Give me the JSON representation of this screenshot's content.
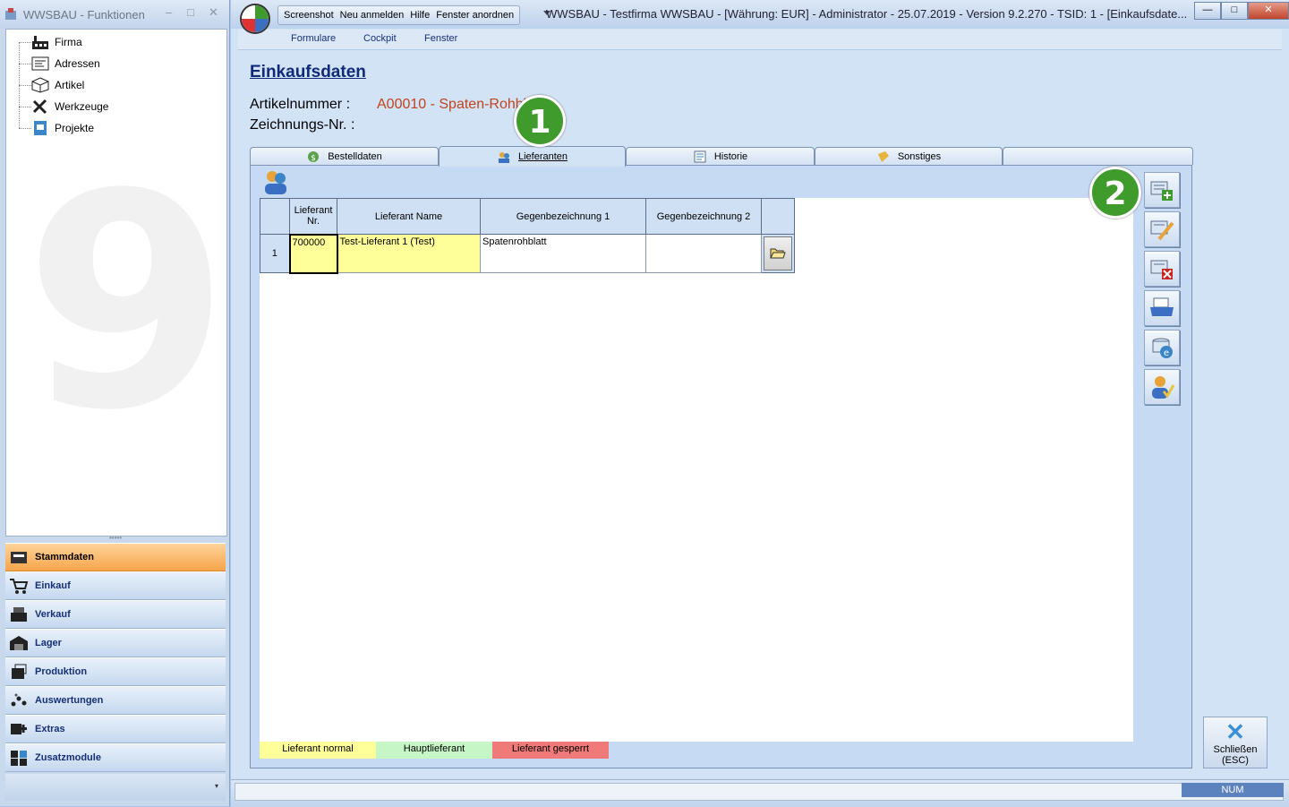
{
  "left_window": {
    "title": "WWSBAU - Funktionen",
    "controls": {
      "minimize": "–",
      "maximize": "□",
      "close": "✕"
    },
    "watermark": "9",
    "tree": [
      {
        "label": "Firma",
        "icon": "factory-icon"
      },
      {
        "label": "Adressen",
        "icon": "address-card-icon"
      },
      {
        "label": "Artikel",
        "icon": "package-icon"
      },
      {
        "label": "Werkzeuge",
        "icon": "tools-icon"
      },
      {
        "label": "Projekte",
        "icon": "project-icon"
      }
    ],
    "nav": [
      {
        "label": "Stammdaten",
        "active": true
      },
      {
        "label": "Einkauf"
      },
      {
        "label": "Verkauf"
      },
      {
        "label": "Lager"
      },
      {
        "label": "Produktion"
      },
      {
        "label": "Auswertungen"
      },
      {
        "label": "Extras"
      },
      {
        "label": "Zusatzmodule"
      }
    ],
    "footer_chevron": "▾"
  },
  "main_window": {
    "quick_access": [
      "Screenshot",
      "Neu anmelden",
      "Hilfe",
      "Fenster anordnen"
    ],
    "title": "WWSBAU - Testfirma WWSBAU - [Währung: EUR] - Administrator - 25.07.2019 - Version 9.2.270 - TSID: 1  - [Einkaufsdate...",
    "controls": {
      "minimize": "—",
      "maximize": "□",
      "close": "✕"
    },
    "menu": [
      "Formulare",
      "Cockpit",
      "Fenster"
    ]
  },
  "page": {
    "title": "Einkaufsdaten",
    "artikelnummer_label": "Artikelnummer :",
    "artikelnummer_value": "A00010 - Spaten-Rohblatt",
    "zeichnung_label": "Zeichnungs-Nr. :"
  },
  "badges": [
    "1",
    "2"
  ],
  "tabs": [
    {
      "label": "Bestelldaten",
      "icon": "money-icon"
    },
    {
      "label": "Lieferanten",
      "icon": "suppliers-icon",
      "active": true
    },
    {
      "label": "Historie",
      "icon": "history-icon"
    },
    {
      "label": "Sonstiges",
      "icon": "misc-icon"
    }
  ],
  "grid": {
    "columns": [
      "Lieferant Nr.",
      "Lieferant Name",
      "Gegenbezeichnung 1",
      "Gegenbezeichnung 2"
    ],
    "rows": [
      {
        "num": "1",
        "lieferant_nr": "700000",
        "lieferant_name": "Test-Lieferant 1  (Test)",
        "gegen1": "Spatenrohblatt",
        "gegen2": ""
      }
    ]
  },
  "legend": [
    {
      "label": "Lieferant normal",
      "color": "#ffff99"
    },
    {
      "label": "Hauptlieferant",
      "color": "#c6f5c6"
    },
    {
      "label": "Lieferant gesperrt",
      "color": "#f07a7a"
    }
  ],
  "side_buttons": [
    "add-record-icon",
    "edit-record-icon",
    "delete-record-icon",
    "print-icon",
    "refresh-icon",
    "user-check-icon"
  ],
  "close_button": {
    "label": "Schließen",
    "shortcut": "(ESC)"
  },
  "status": {
    "num": "NUM"
  }
}
